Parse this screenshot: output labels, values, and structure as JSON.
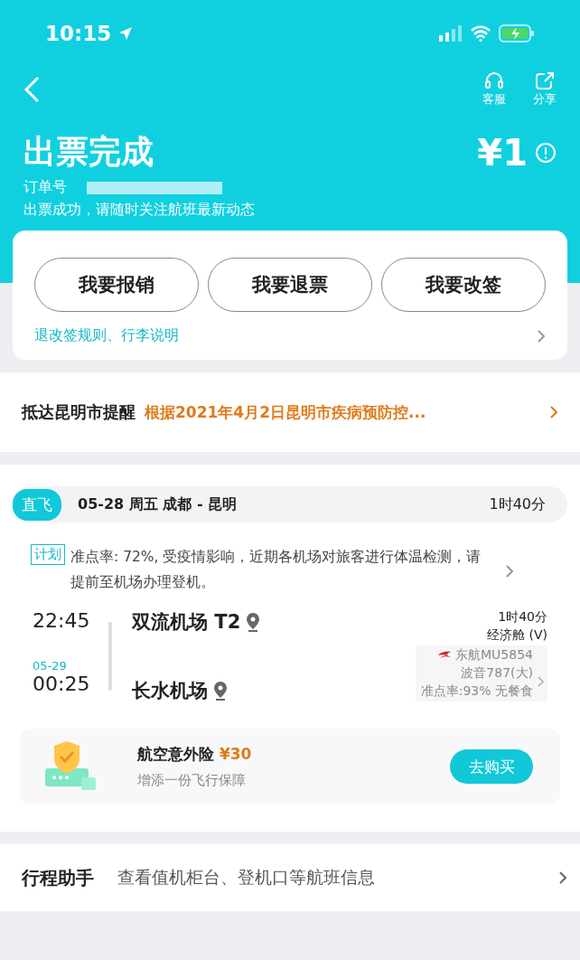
{
  "status_bar": {
    "time": "10:15"
  },
  "nav": {
    "actions": [
      {
        "kind": "service",
        "label": "客服"
      },
      {
        "kind": "share",
        "label": "分享"
      }
    ]
  },
  "header": {
    "title": "出票完成",
    "price": "¥1",
    "order_label": "订单号",
    "message": "出票成功，请随时关注航班最新动态"
  },
  "actions": {
    "buttons": [
      "我要报销",
      "我要退票",
      "我要改签"
    ],
    "rules_link": "退改签规则、行李说明"
  },
  "reminder": {
    "label": "抵达昆明市提醒",
    "text": "根据2021年4月2日昆明市疾病预防控..."
  },
  "flight": {
    "tag": "直飞",
    "summary": "05-28  周五  成都 - 昆明",
    "duration": "1时40分",
    "notice_tag": "计划",
    "notice": "准点率: 72%, 受疫情影响，近期各机场对旅客进行体温检测，请提前至机场办理登机。",
    "depart": {
      "time": "22:45",
      "airport": "双流机场 T2"
    },
    "arrive": {
      "date": "05-29",
      "time": "00:25",
      "airport": "长水机场"
    },
    "info": {
      "duration": "1时40分",
      "cabin": "经济舱 (V)",
      "airline": "东航MU5854",
      "aircraft": "波音787(大)",
      "stats": "准点率:93% 无餐食"
    }
  },
  "insurance": {
    "title": "航空意外险",
    "price": "¥30",
    "subtitle": "增添一份飞行保障",
    "button": "去购买"
  },
  "assistant": {
    "title": "行程助手",
    "text": "查看值机柜台、登机口等航班信息"
  }
}
